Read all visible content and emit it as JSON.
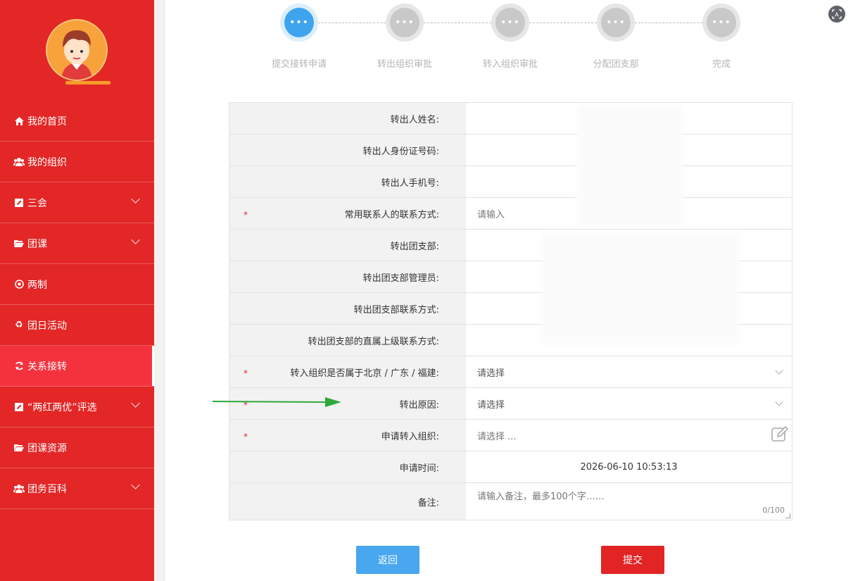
{
  "sidebar": {
    "items": [
      {
        "label": "我的首页",
        "icon": "home-icon",
        "has_submenu": false
      },
      {
        "label": "我的组织",
        "icon": "users-icon",
        "has_submenu": false
      },
      {
        "label": "三会",
        "icon": "edit-icon",
        "has_submenu": true
      },
      {
        "label": "团课",
        "icon": "folder-icon",
        "has_submenu": true
      },
      {
        "label": "两制",
        "icon": "target-icon",
        "has_submenu": false
      },
      {
        "label": "团日活动",
        "icon": "recycle-icon",
        "has_submenu": false
      },
      {
        "label": "关系接转",
        "icon": "refresh-icon",
        "has_submenu": false,
        "active": true
      },
      {
        "label": "“两红两优”评选",
        "icon": "edit-icon",
        "has_submenu": true
      },
      {
        "label": "团课资源",
        "icon": "folder-icon",
        "has_submenu": false
      },
      {
        "label": "团务百科",
        "icon": "users-icon",
        "has_submenu": true
      }
    ]
  },
  "steps": [
    {
      "label": "提交接转申请",
      "active": true
    },
    {
      "label": "转出组织审批",
      "active": false
    },
    {
      "label": "转入组织审批",
      "active": false
    },
    {
      "label": "分配团支部",
      "active": false
    },
    {
      "label": "完成",
      "active": false
    }
  ],
  "form": {
    "rows": [
      {
        "label": "转出人姓名:",
        "required": false,
        "value": ""
      },
      {
        "label": "转出人身份证号码:",
        "required": false,
        "value": ""
      },
      {
        "label": "转出人手机号:",
        "required": false,
        "value": ""
      },
      {
        "label": "常用联系人的联系方式:",
        "required": true,
        "placeholder": "请输入"
      },
      {
        "label": "转出团支部:",
        "required": false,
        "value": ""
      },
      {
        "label": "转出团支部管理员:",
        "required": false,
        "value": ""
      },
      {
        "label": "转出团支部联系方式:",
        "required": false,
        "value": ""
      },
      {
        "label": "转出团支部的直属上级联系方式:",
        "required": false,
        "value": ""
      },
      {
        "label": "转入组织是否属于北京 / 广东 / 福建:",
        "required": true,
        "placeholder": "请选择"
      },
      {
        "label": "转出原因:",
        "required": true,
        "placeholder": "请选择"
      },
      {
        "label": "申请转入组织:",
        "required": true,
        "placeholder": "请选择 ..."
      },
      {
        "label": "申请时间:",
        "required": false,
        "value": "2026-06-10 10:53:13"
      },
      {
        "label": "备注:",
        "required": false,
        "placeholder": "请输入备注，最多100个字……",
        "counter": "0/100"
      }
    ],
    "required_mark": "*"
  },
  "buttons": {
    "back": "返回",
    "submit": "提交"
  },
  "colors": {
    "sidebar": "#e32626",
    "active_step": "#3ea4ee",
    "back_button": "#48a7ef",
    "submit_button": "#e22424",
    "arrow": "#2fa83a"
  }
}
